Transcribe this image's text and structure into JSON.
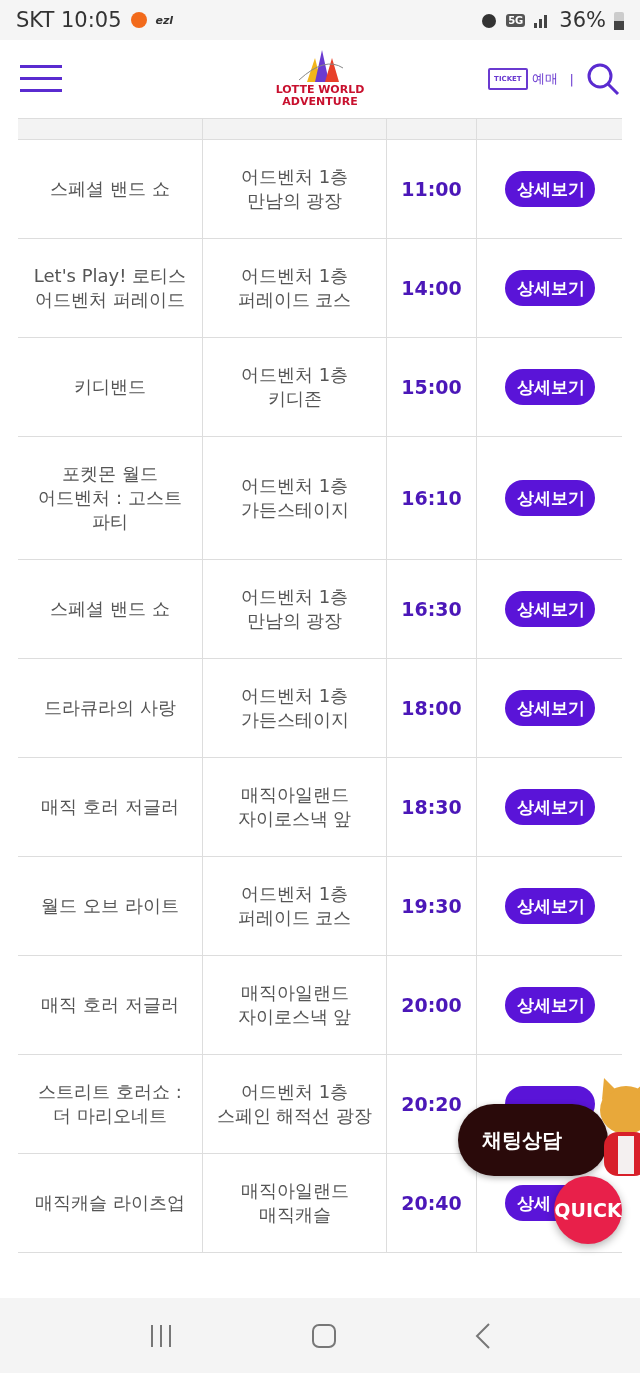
{
  "status_bar": {
    "carrier_time": "SKT 10:05",
    "app_label": "ezl",
    "network": "5G",
    "battery": "36%"
  },
  "header": {
    "logo_line1": "LOTTE WORLD",
    "logo_line2": "ADVENTURE",
    "ticket_badge": "TICKET",
    "ticket_label": "예매",
    "separator": "|"
  },
  "schedule": [
    {
      "title": "스페셜 밴드 쇼",
      "place": "어드벤처 1층 만남의 광장",
      "time": "11:00",
      "button": "상세보기"
    },
    {
      "title": "Let's Play! 로티스 어드벤처 퍼레이드",
      "place": "어드벤처 1층 퍼레이드 코스",
      "time": "14:00",
      "button": "상세보기"
    },
    {
      "title": "키디밴드",
      "place": "어드벤처 1층 키디존",
      "time": "15:00",
      "button": "상세보기"
    },
    {
      "title": "포켓몬 월드 어드벤처 : 고스트 파티",
      "place": "어드벤처 1층 가든스테이지",
      "time": "16:10",
      "button": "상세보기"
    },
    {
      "title": "스페셜 밴드 쇼",
      "place": "어드벤처 1층 만남의 광장",
      "time": "16:30",
      "button": "상세보기"
    },
    {
      "title": "드라큐라의 사랑",
      "place": "어드벤처 1층 가든스테이지",
      "time": "18:00",
      "button": "상세보기"
    },
    {
      "title": "매직 호러 저글러",
      "place": "매직아일랜드 자이로스낵 앞",
      "time": "18:30",
      "button": "상세보기"
    },
    {
      "title": "월드 오브 라이트",
      "place": "어드벤처 1층 퍼레이드 코스",
      "time": "19:30",
      "button": "상세보기"
    },
    {
      "title": "매직 호러 저글러",
      "place": "매직아일랜드 자이로스낵 앞",
      "time": "20:00",
      "button": "상세보기"
    },
    {
      "title": "스트리트 호러쇼 : 더 마리오네트",
      "place": "어드벤처 1층 스페인 해적선 광장",
      "time": "20:20"
    },
    {
      "title": "매직캐슬 라이츠업",
      "place": "매직아일랜드 매직캐슬",
      "time": "20:40",
      "button": "상세"
    }
  ],
  "chat_button": "채팅상담",
  "quick_button": "QUICK"
}
